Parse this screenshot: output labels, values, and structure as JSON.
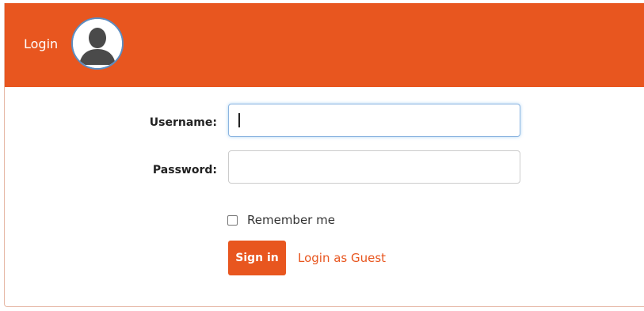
{
  "header": {
    "title": "Login",
    "avatar_icon": "user-silhouette-icon"
  },
  "form": {
    "username_label": "Username:",
    "username_value": "",
    "password_label": "Password:",
    "password_value": "",
    "remember_label": "Remember me",
    "remember_checked": false,
    "signin_label": "Sign in",
    "guest_link_label": "Login as Guest"
  },
  "colors": {
    "accent": "#e8561f",
    "focus_border": "#8bb4e0",
    "avatar_ring": "#5d8dc0",
    "avatar_figure": "#4a4a4a"
  }
}
